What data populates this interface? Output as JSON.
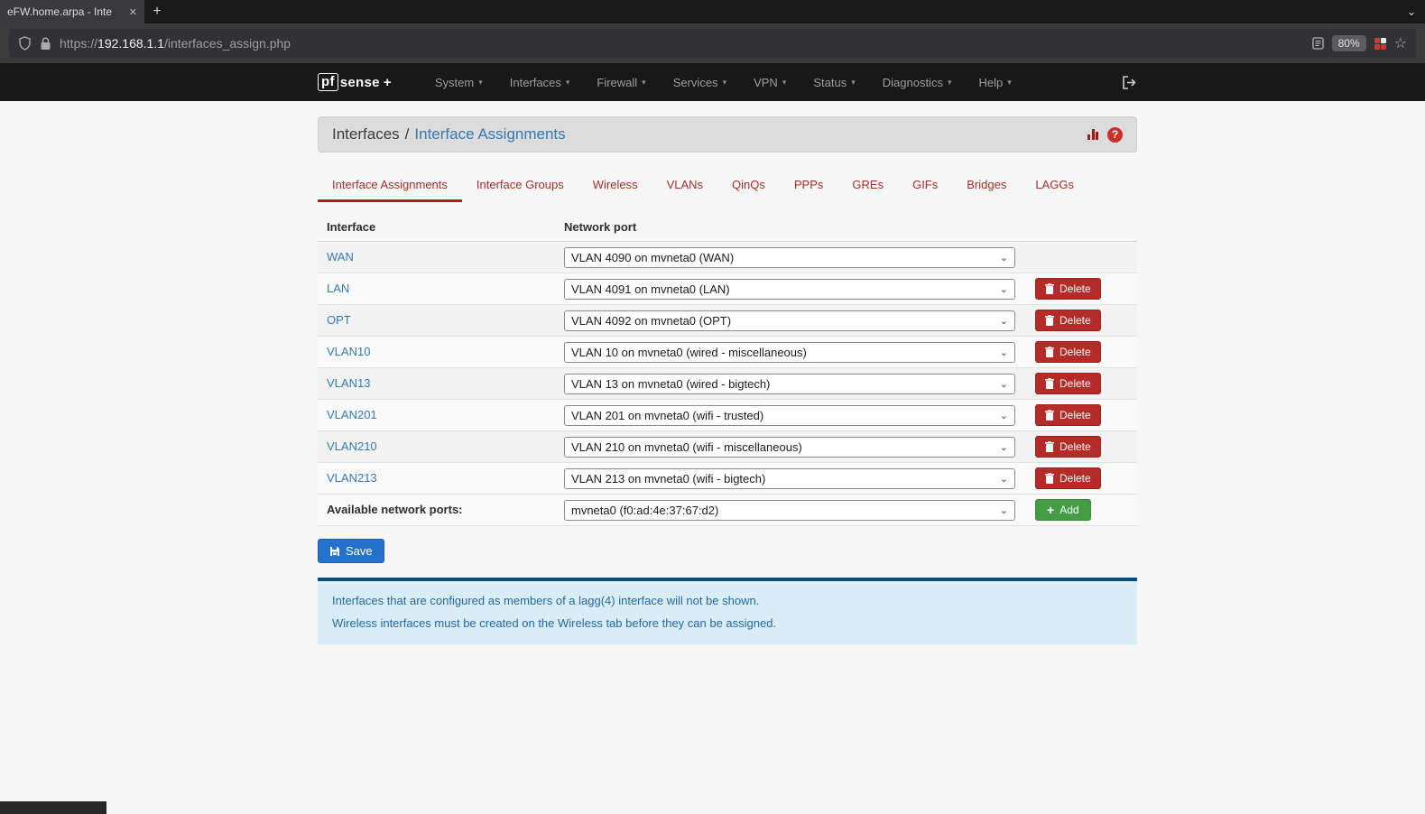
{
  "browser": {
    "tab_title": "eFW.home.arpa - Inte",
    "url_scheme": "https://",
    "url_host": "192.168.1.1",
    "url_path": "/interfaces_assign.php",
    "zoom": "80%"
  },
  "icons": {
    "caret": "▾",
    "close": "✕",
    "plus": "+",
    "chevron": "⌄",
    "star": "☆"
  },
  "navbar": {
    "brand_pf": "pf",
    "brand_sense": "sense",
    "brand_plus": "+",
    "items": [
      {
        "label": "System"
      },
      {
        "label": "Interfaces"
      },
      {
        "label": "Firewall"
      },
      {
        "label": "Services"
      },
      {
        "label": "VPN"
      },
      {
        "label": "Status"
      },
      {
        "label": "Diagnostics"
      },
      {
        "label": "Help"
      }
    ]
  },
  "breadcrumb": {
    "section": "Interfaces",
    "separator": "/",
    "page": "Interface Assignments"
  },
  "tabs": [
    {
      "label": "Interface Assignments",
      "active": true
    },
    {
      "label": "Interface Groups",
      "active": false
    },
    {
      "label": "Wireless",
      "active": false
    },
    {
      "label": "VLANs",
      "active": false
    },
    {
      "label": "QinQs",
      "active": false
    },
    {
      "label": "PPPs",
      "active": false
    },
    {
      "label": "GREs",
      "active": false
    },
    {
      "label": "GIFs",
      "active": false
    },
    {
      "label": "Bridges",
      "active": false
    },
    {
      "label": "LAGGs",
      "active": false
    }
  ],
  "assign": {
    "headers": {
      "interface": "Interface",
      "port": "Network port"
    },
    "rows": [
      {
        "name": "WAN",
        "port": "VLAN 4090 on mvneta0 (WAN)"
      },
      {
        "name": "LAN",
        "port": "VLAN 4091 on mvneta0 (LAN)"
      },
      {
        "name": "OPT",
        "port": "VLAN 4092 on mvneta0 (OPT)"
      },
      {
        "name": "VLAN10",
        "port": "VLAN 10 on mvneta0 (wired - miscellaneous)"
      },
      {
        "name": "VLAN13",
        "port": "VLAN 13 on mvneta0 (wired - bigtech)"
      },
      {
        "name": "VLAN201",
        "port": "VLAN 201 on mvneta0 (wifi - trusted)"
      },
      {
        "name": "VLAN210",
        "port": "VLAN 210 on mvneta0 (wifi - miscellaneous)"
      },
      {
        "name": "VLAN213",
        "port": "VLAN 213 on mvneta0 (wifi - bigtech)"
      }
    ],
    "available": {
      "label": "Available network ports:",
      "port": "mvneta0 (f0:ad:4e:37:67:d2)"
    }
  },
  "labels": {
    "delete": "Delete",
    "add": "Add",
    "save": "Save"
  },
  "info": {
    "line1": "Interfaces that are configured as members of a lagg(4) interface will not be shown.",
    "line2": "Wireless interfaces must be created on the Wireless tab before they can be assigned."
  },
  "colors": {
    "link_blue": "#337ab7",
    "tab_red": "#a12f28",
    "delete_red": "#b52b27",
    "add_green": "#449d44",
    "save_blue": "#2572cc",
    "info_bg": "#d9edf7",
    "info_border": "#0b4d77",
    "navbar_bg": "#181818"
  }
}
